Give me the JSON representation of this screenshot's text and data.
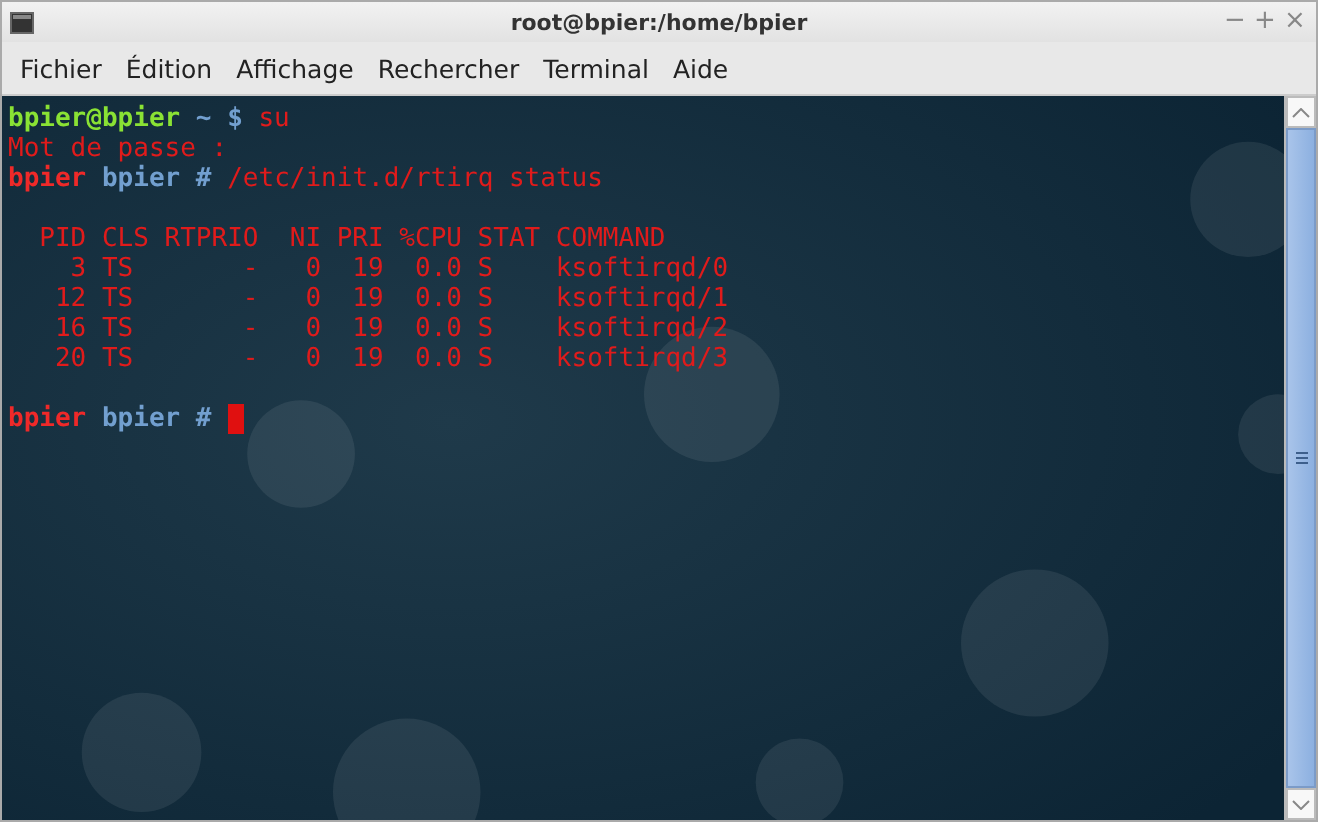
{
  "window": {
    "title": "root@bpier:/home/bpier",
    "controls": [
      "−",
      "+",
      "×"
    ]
  },
  "menu": [
    "Fichier",
    "Édition",
    "Affichage",
    "Rechercher",
    "Terminal",
    "Aide"
  ],
  "terminal": {
    "lines": [
      {
        "kind": "text",
        "segments": [
          {
            "kind": "user",
            "text": "bpier@bpier"
          },
          {
            "kind": "symbol",
            "text": " ~ $ "
          },
          {
            "kind": "output",
            "text": "su"
          }
        ]
      },
      {
        "kind": "text",
        "segments": [
          {
            "kind": "output",
            "text": "Mot de passe :"
          }
        ]
      },
      {
        "kind": "text",
        "segments": [
          {
            "kind": "root",
            "text": "bpier"
          },
          {
            "kind": "symbol",
            "text": " bpier # "
          },
          {
            "kind": "output",
            "text": "/etc/init.d/rtirq status"
          }
        ]
      },
      {
        "kind": "blank"
      },
      {
        "kind": "text",
        "segments": [
          {
            "kind": "output",
            "text": "  PID CLS RTPRIO  NI PRI %CPU STAT COMMAND"
          }
        ]
      },
      {
        "kind": "text",
        "segments": [
          {
            "kind": "output",
            "text": "    3 TS       -   0  19  0.0 S    ksoftirqd/0"
          }
        ]
      },
      {
        "kind": "text",
        "segments": [
          {
            "kind": "output",
            "text": "   12 TS       -   0  19  0.0 S    ksoftirqd/1"
          }
        ]
      },
      {
        "kind": "text",
        "segments": [
          {
            "kind": "output",
            "text": "   16 TS       -   0  19  0.0 S    ksoftirqd/2"
          }
        ]
      },
      {
        "kind": "text",
        "segments": [
          {
            "kind": "output",
            "text": "   20 TS       -   0  19  0.0 S    ksoftirqd/3"
          }
        ]
      },
      {
        "kind": "blank"
      },
      {
        "kind": "text",
        "cursor": true,
        "segments": [
          {
            "kind": "root",
            "text": "bpier"
          },
          {
            "kind": "symbol",
            "text": " bpier # "
          }
        ]
      }
    ]
  }
}
